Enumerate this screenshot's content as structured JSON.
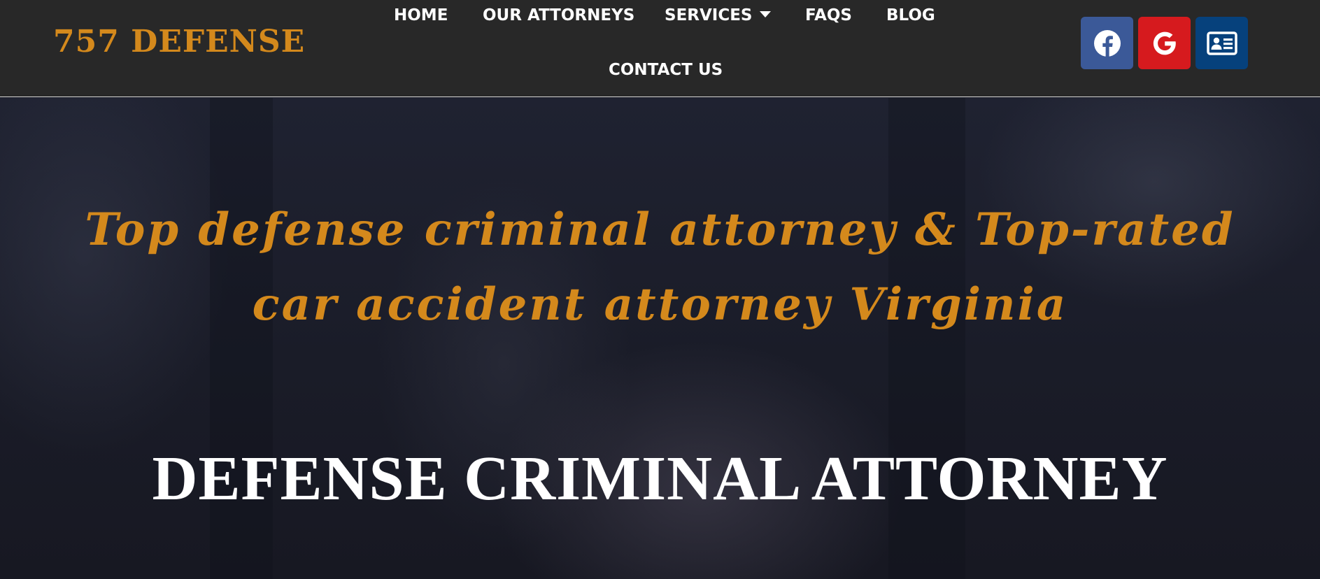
{
  "header": {
    "logo_text": "757 DEFENSE",
    "nav": {
      "home": "HOME",
      "attorneys": "OUR ATTORNEYS",
      "services": "SERVICES",
      "faqs": "FAQS",
      "blog": "BLOG",
      "contact": "CONTACT US"
    },
    "social": [
      {
        "name": "facebook",
        "icon": "facebook-icon",
        "color": "#3b5998"
      },
      {
        "name": "google",
        "icon": "google-icon",
        "color": "#d61a1e"
      },
      {
        "name": "contact-card",
        "icon": "contact-card-icon",
        "color": "#06417c"
      }
    ]
  },
  "hero": {
    "tagline": "Top defense criminal attorney & Top-rated car accident attorney Virginia",
    "title": "DEFENSE CRIMINAL ATTORNEY"
  },
  "colors": {
    "accent": "#d4891c",
    "header_bg": "#282828",
    "hero_bg": "#1b1d29"
  }
}
